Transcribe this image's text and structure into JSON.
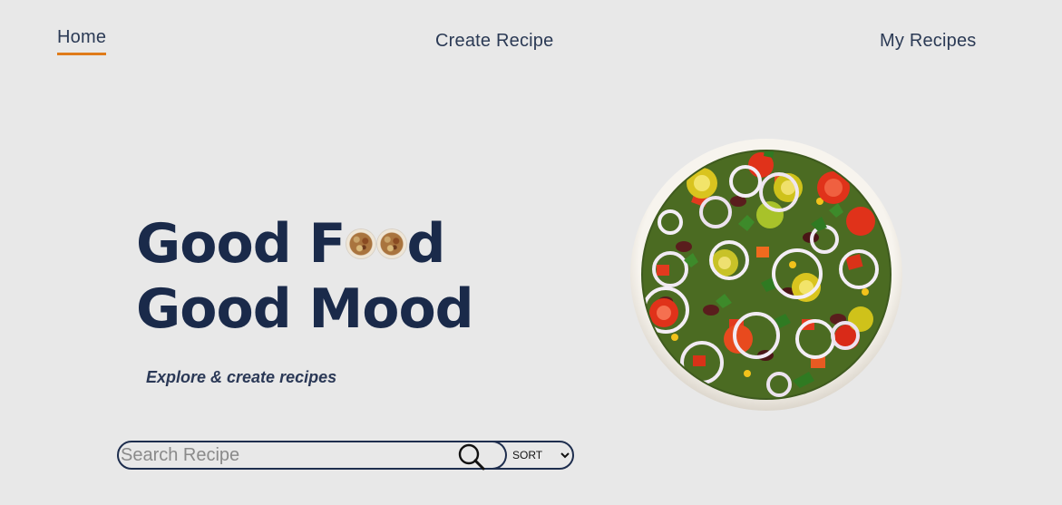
{
  "nav": {
    "home": "Home",
    "create": "Create Recipe",
    "mine": "My Recipes"
  },
  "hero": {
    "line1_start": "Good F",
    "line1_end": "d",
    "line2": "Good Mood",
    "tagline": "Explore & create recipes"
  },
  "search": {
    "placeholder": "Search Recipe",
    "sort_label": "SORT"
  },
  "colors": {
    "accent": "#e07b1a",
    "navy": "#1a2a4a",
    "background": "#e8e8e8"
  },
  "icons": {
    "search": "search-icon",
    "food_o": "food-bowl-icon",
    "salad": "salad-bowl-image"
  }
}
